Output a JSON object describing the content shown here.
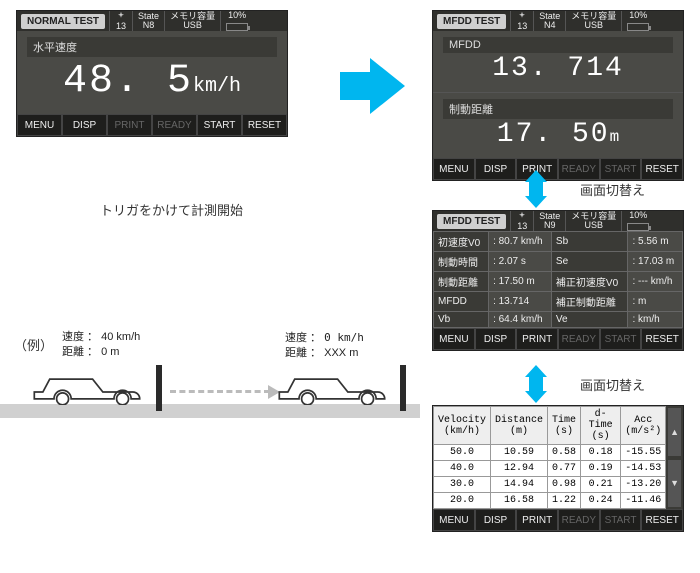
{
  "panel1": {
    "title": "NORMAL TEST",
    "sat": "13",
    "state_lab": "State",
    "state": "N8",
    "mem_lab": "メモリ容量",
    "usb": "USB",
    "batt": "10%",
    "metric_label": "水平速度",
    "value": "48. 5",
    "unit": "km/h",
    "buttons": [
      "MENU",
      "DISP",
      "PRINT",
      "READY",
      "START",
      "RESET"
    ]
  },
  "arrow_caption": "トリガをかけて計測開始",
  "example_label": "（例）",
  "car_left": {
    "speed_lab": "速度 ：",
    "speed": "40 km/h",
    "dist_lab": "距離 ：",
    "dist": "0 m"
  },
  "car_right": {
    "speed_lab": "速度 ：",
    "speed": "0  km/h",
    "dist_lab": "距離 ：",
    "dist": "XXX m"
  },
  "panel2": {
    "title": "MFDD TEST",
    "sat": "13",
    "state_lab": "State",
    "state": "N4",
    "mem_lab": "メモリ容量",
    "usb": "USB",
    "batt": "10%",
    "row1_label": "MFDD",
    "row1_value": "13. 714",
    "row1_unit": "",
    "row2_label": "制動距離",
    "row2_value": "17. 50",
    "row2_unit": "m",
    "buttons": [
      "MENU",
      "DISP",
      "PRINT",
      "READY",
      "START",
      "RESET"
    ]
  },
  "switch_label": "画面切替え",
  "panel3": {
    "title": "MFDD TEST",
    "sat": "13",
    "state_lab": "State",
    "state": "N9",
    "mem_lab": "メモリ容量",
    "usb": "USB",
    "batt": "10%",
    "rows": [
      [
        "初速度V0",
        ": 80.7 km/h",
        "Sb",
        ": 5.56 m"
      ],
      [
        "制動時間",
        ": 2.07 s",
        "Se",
        ": 17.03 m"
      ],
      [
        "制動距離",
        ": 17.50 m",
        "補正初速度V0",
        ": --- km/h"
      ],
      [
        "MFDD",
        ": 13.714",
        "補正制動距離",
        ":        m"
      ],
      [
        "Vb",
        ": 64.4 km/h",
        "Ve",
        ":      km/h"
      ]
    ],
    "buttons": [
      "MENU",
      "DISP",
      "PRINT",
      "READY",
      "START",
      "RESET"
    ]
  },
  "panel4": {
    "headers": [
      "Velocity\n(km/h)",
      "Distance\n(m)",
      "Time\n(s)",
      "d-Time\n(s)",
      "Acc\n(m/s²)"
    ],
    "rows": [
      [
        "50.0",
        "10.59",
        "0.58",
        "0.18",
        "-15.55"
      ],
      [
        "40.0",
        "12.94",
        "0.77",
        "0.19",
        "-14.53"
      ],
      [
        "30.0",
        "14.94",
        "0.98",
        "0.21",
        "-13.20"
      ],
      [
        "20.0",
        "16.58",
        "1.22",
        "0.24",
        "-11.46"
      ]
    ],
    "scroll_up": "▲",
    "scroll_dn": "▼",
    "buttons": [
      "MENU",
      "DISP",
      "PRINT",
      "READY",
      "START",
      "RESET"
    ]
  }
}
